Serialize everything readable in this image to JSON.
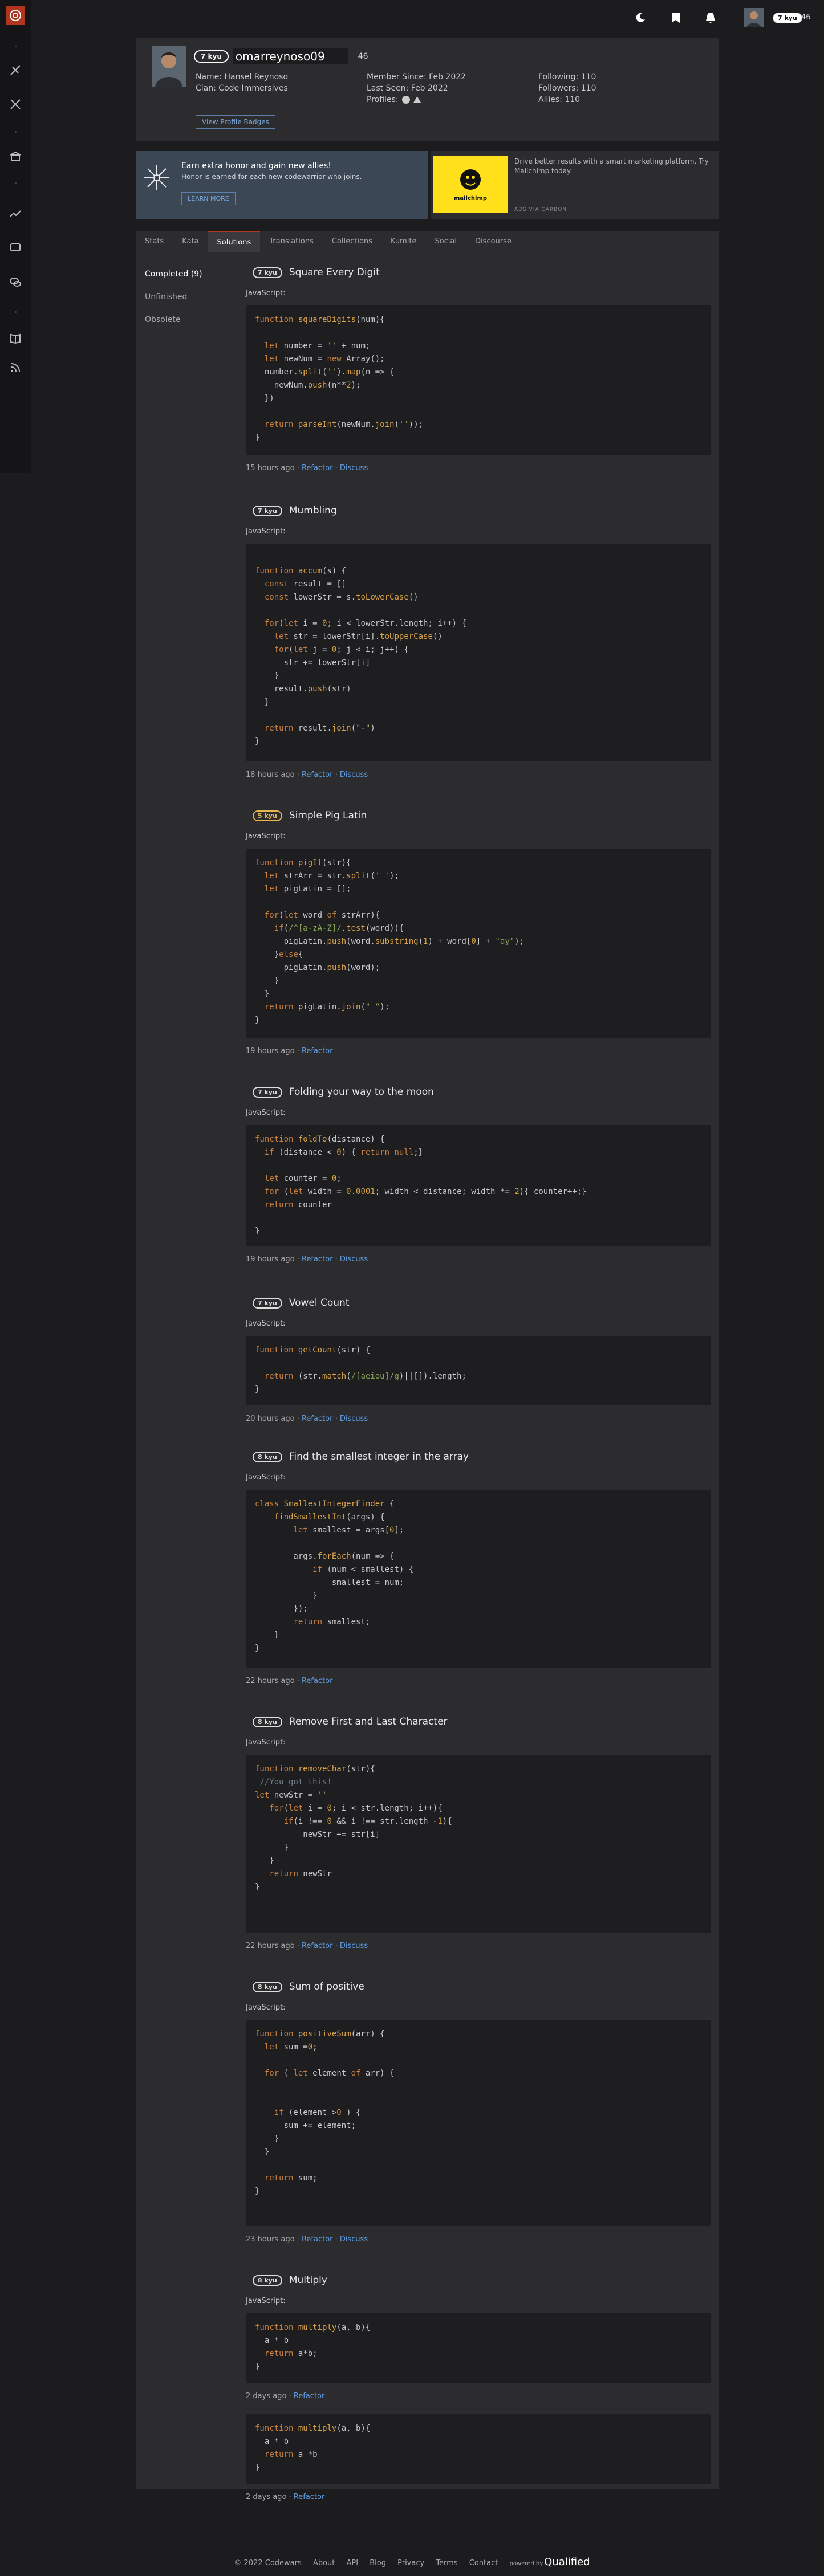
{
  "user": {
    "username": "omarreynoso09",
    "rank": "7 kyu",
    "honor": "46",
    "name_label": "Name:",
    "name": "Hansel Reynoso",
    "clan_label": "Clan:",
    "clan": "Code Immersives",
    "member_since_label": "Member Since:",
    "member_since": "Feb 2022",
    "last_seen_label": "Last Seen:",
    "last_seen": "Feb 2022",
    "profiles_label": "Profiles:",
    "following_label": "Following:",
    "following": "110",
    "followers_label": "Followers:",
    "followers": "110",
    "allies_label": "Allies:",
    "allies": "110",
    "badges_button": "View Profile Badges"
  },
  "topbar": {
    "rank": "7 kyu",
    "honor": "46"
  },
  "promo": {
    "title": "Earn extra honor and gain new allies!",
    "subtitle": "Honor is earned for each new codewarrior who joins.",
    "button": "LEARN MORE"
  },
  "ad": {
    "text": "Drive better results with a smart marketing platform. Try Mailchimp today.",
    "brand": "mailchimp",
    "via": "ADS VIA CARBON"
  },
  "tabs": [
    "Stats",
    "Kata",
    "Solutions",
    "Translations",
    "Collections",
    "Kumite",
    "Social",
    "Discourse"
  ],
  "subnav": [
    "Completed (9)",
    "Unfinished",
    "Obsolete"
  ],
  "katas": [
    {
      "rank": "7 kyu",
      "name": "Square Every Digit",
      "lang": "JavaScript:",
      "time": "15 hours ago",
      "refactor": "Refactor",
      "discuss": "Discuss"
    },
    {
      "rank": "7 kyu",
      "name": "Mumbling",
      "lang": "JavaScript:",
      "time": "18 hours ago",
      "refactor": "Refactor",
      "discuss": "Discuss"
    },
    {
      "rank": "5 kyu",
      "name": "Simple Pig Latin",
      "lang": "JavaScript:",
      "time": "19 hours ago",
      "refactor": "Refactor",
      "discuss": ""
    },
    {
      "rank": "7 kyu",
      "name": "Folding your way to the moon",
      "lang": "JavaScript:",
      "time": "19 hours ago",
      "refactor": "Refactor",
      "discuss": "Discuss"
    },
    {
      "rank": "7 kyu",
      "name": "Vowel Count",
      "lang": "JavaScript:",
      "time": "20 hours ago",
      "refactor": "Refactor",
      "discuss": "Discuss"
    },
    {
      "rank": "8 kyu",
      "name": "Find the smallest integer in the array",
      "lang": "JavaScript:",
      "time": "22 hours ago",
      "refactor": "Refactor",
      "discuss": ""
    },
    {
      "rank": "8 kyu",
      "name": "Remove First and Last Character",
      "lang": "JavaScript:",
      "time": "22 hours ago",
      "refactor": "Refactor",
      "discuss": "Discuss"
    },
    {
      "rank": "8 kyu",
      "name": "Sum of positive",
      "lang": "JavaScript:",
      "time": "23 hours ago",
      "refactor": "Refactor",
      "discuss": "Discuss"
    },
    {
      "rank": "8 kyu",
      "name": "Multiply",
      "lang": "JavaScript:",
      "time": "2 days ago",
      "refactor": "Refactor",
      "discuss": "",
      "time2": "2 days ago",
      "refactor2": "Refactor"
    }
  ],
  "footer": {
    "copyright": "© 2022 Codewars",
    "links": [
      "About",
      "API",
      "Blog",
      "Privacy",
      "Terms",
      "Contact"
    ],
    "powered": "powered by",
    "brand": "Qualified"
  },
  "colors": {
    "accent": "#b1361e",
    "link": "#5e9be0",
    "yellow_rank": "#e8b64f"
  }
}
